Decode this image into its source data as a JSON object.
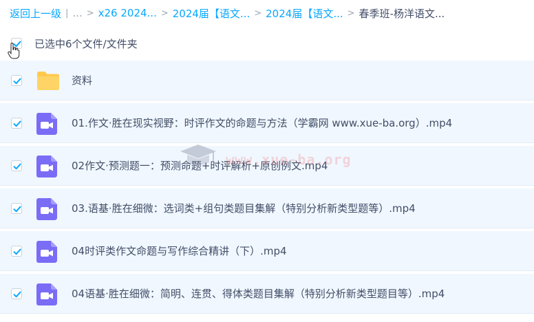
{
  "breadcrumb": {
    "back": "返回上一级",
    "ellipsis": "...",
    "items": [
      "x26 2024...",
      "2024届【语文...",
      "2024届【语文..."
    ],
    "current": "春季班-杨洋语文..."
  },
  "selection": {
    "label": "已选中6个文件/文件夹",
    "checked": true
  },
  "files": [
    {
      "name": "资料",
      "type": "folder",
      "checked": true
    },
    {
      "name": "01.作文·胜在现实视野：时评作文的命题与方法（学霸网 www.xue-ba.org）.mp4",
      "type": "video",
      "checked": true
    },
    {
      "name": "02作文·预测题一：预测命题+时评解析+原创例文.mp4",
      "type": "video",
      "checked": true
    },
    {
      "name": "03.语基·胜在细微：选词类+组句类题目集解（特别分析新类型题等）.mp4",
      "type": "video",
      "checked": true
    },
    {
      "name": "04时评类作文命题与写作综合精讲（下）.mp4",
      "type": "video",
      "checked": true
    },
    {
      "name": "04语基·胜在细微：简明、连贯、得体类题目集解（特别分析新类型题目等）.mp4",
      "type": "video",
      "checked": true
    }
  ],
  "watermark": {
    "text": "www.xue-ba.org"
  },
  "colors": {
    "accent": "#06a7ff",
    "row_selected_bg": "#f0f7ff",
    "folder": "#ffc94d",
    "video": "#7b6cf6",
    "text": "#424e67"
  },
  "icons": {
    "check": "check-icon",
    "folder": "folder-icon",
    "video": "video-camera-icon",
    "cursor": "hand-pointer-icon",
    "separator": "chevron-right-icon"
  }
}
